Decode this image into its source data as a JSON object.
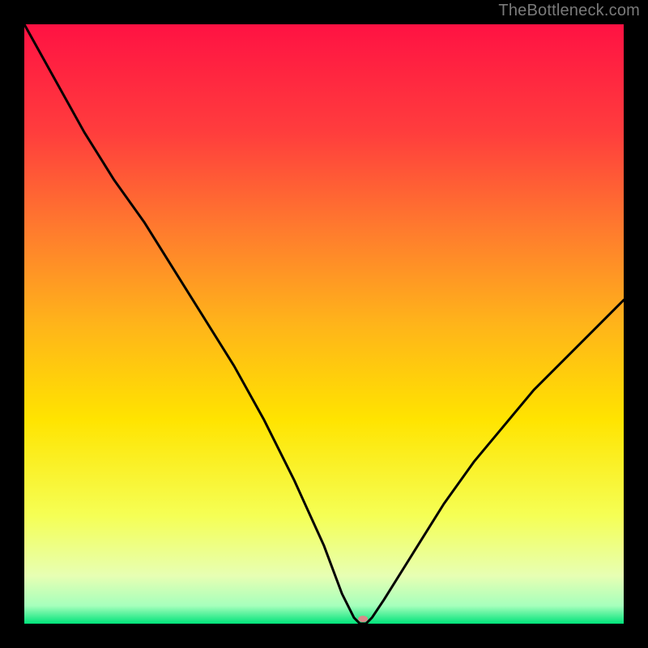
{
  "watermark": "TheBottleneck.com",
  "chart_data": {
    "type": "line",
    "title": "",
    "xlabel": "",
    "ylabel": "",
    "xlim": [
      0,
      100
    ],
    "ylim": [
      0,
      100
    ],
    "grid": false,
    "background": {
      "gradient_stops": [
        {
          "y": 100,
          "color": "#ff1243"
        },
        {
          "y": 82,
          "color": "#ff3d3d"
        },
        {
          "y": 66,
          "color": "#ff7a2e"
        },
        {
          "y": 50,
          "color": "#ffb41a"
        },
        {
          "y": 34,
          "color": "#ffe400"
        },
        {
          "y": 18,
          "color": "#f5ff55"
        },
        {
          "y": 8,
          "color": "#e7ffb3"
        },
        {
          "y": 3,
          "color": "#a6ffbc"
        },
        {
          "y": 0,
          "color": "#00e37a"
        }
      ]
    },
    "series": [
      {
        "name": "bottleneck-curve",
        "color": "#000000",
        "x": [
          0,
          5,
          10,
          15,
          20,
          25,
          30,
          35,
          40,
          45,
          50,
          53,
          55,
          56,
          57,
          58,
          60,
          65,
          70,
          75,
          80,
          85,
          90,
          95,
          100
        ],
        "values": [
          100,
          91,
          82,
          74,
          67,
          59,
          51,
          43,
          34,
          24,
          13,
          5,
          1,
          0,
          0,
          1,
          4,
          12,
          20,
          27,
          33,
          39,
          44,
          49,
          54
        ]
      }
    ],
    "marker": {
      "name": "sweet-spot-marker",
      "x": 56.5,
      "y": 0.8,
      "color": "#d98a8a",
      "rx": 6,
      "ry": 4
    }
  }
}
